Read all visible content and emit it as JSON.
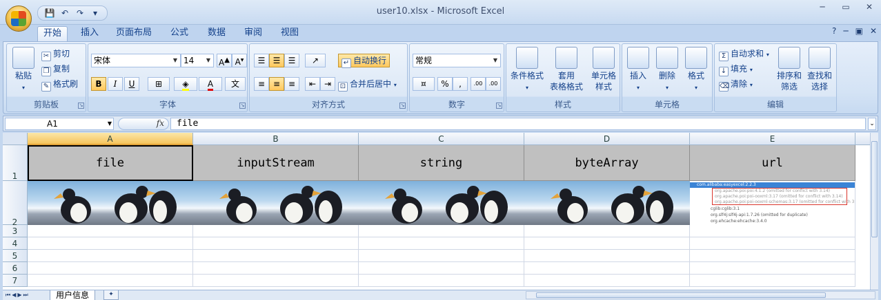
{
  "window": {
    "title": "user10.xlsx - Microsoft Excel"
  },
  "qat": {
    "save": "💾",
    "undo": "↶",
    "redo": "↷",
    "more": "▾"
  },
  "tabs": [
    {
      "label": "开始"
    },
    {
      "label": "插入"
    },
    {
      "label": "页面布局"
    },
    {
      "label": "公式"
    },
    {
      "label": "数据"
    },
    {
      "label": "审阅"
    },
    {
      "label": "视图"
    }
  ],
  "ribbon": {
    "clipboard": {
      "label": "剪贴板",
      "paste": "粘贴",
      "cut": "剪切",
      "copy": "复制",
      "format_painter": "格式刷"
    },
    "font": {
      "label": "字体",
      "font_name": "宋体",
      "font_size": "14",
      "bold": "B",
      "italic": "I",
      "underline": "U"
    },
    "alignment": {
      "label": "对齐方式",
      "wrap_text": "自动换行",
      "merge_center": "合并后居中"
    },
    "number": {
      "label": "数字",
      "format": "常规",
      "percent": "%",
      "comma": ",",
      "inc_dec": ".00",
      "dec_dec": ".00"
    },
    "styles": {
      "label": "样式",
      "conditional": "条件格式",
      "table_line1": "套用",
      "table_line2": "表格格式",
      "cell_line1": "单元格",
      "cell_line2": "样式"
    },
    "cells": {
      "label": "单元格",
      "insert": "插入",
      "delete": "删除",
      "format": "格式"
    },
    "editing": {
      "label": "编辑",
      "autosum": "自动求和",
      "fill": "填充",
      "clear": "清除",
      "sort_line1": "排序和",
      "sort_line2": "筛选",
      "find_line1": "查找和",
      "find_line2": "选择"
    }
  },
  "formula_bar": {
    "name_box": "A1",
    "fx": "fx",
    "content": "file"
  },
  "columns": [
    "A",
    "B",
    "C",
    "D",
    "E"
  ],
  "rows": [
    "1",
    "2",
    "3",
    "4",
    "5",
    "6",
    "7"
  ],
  "header_row": [
    "file",
    "inputStream",
    "string",
    "byteArray",
    "url"
  ],
  "url_image_lines": [
    "com.alibaba:easyexcel:2.2.3",
    "org.apache.poi:poi:4.1.2 (omitted for conflict with 3.14)",
    "org.apache.poi:poi-ooxml:3.17 (omitted for conflict with 3.14)",
    "org.apache.poi:poi-ooxml-schemas:3.17 (omitted for conflict with 3.14)",
    "cglib:cglib:3.1",
    "org.slf4j:slf4j-api:1.7.26 (omitted for duplicate)",
    "org.ehcache:ehcache:3.4.0"
  ],
  "sheets": [
    {
      "label": "用户信息"
    }
  ],
  "colors": {
    "accent": "#15428b",
    "selected_header": "#f6c55d",
    "header_fill": "#c0c0c0",
    "highlight_box": "#d9342b"
  }
}
